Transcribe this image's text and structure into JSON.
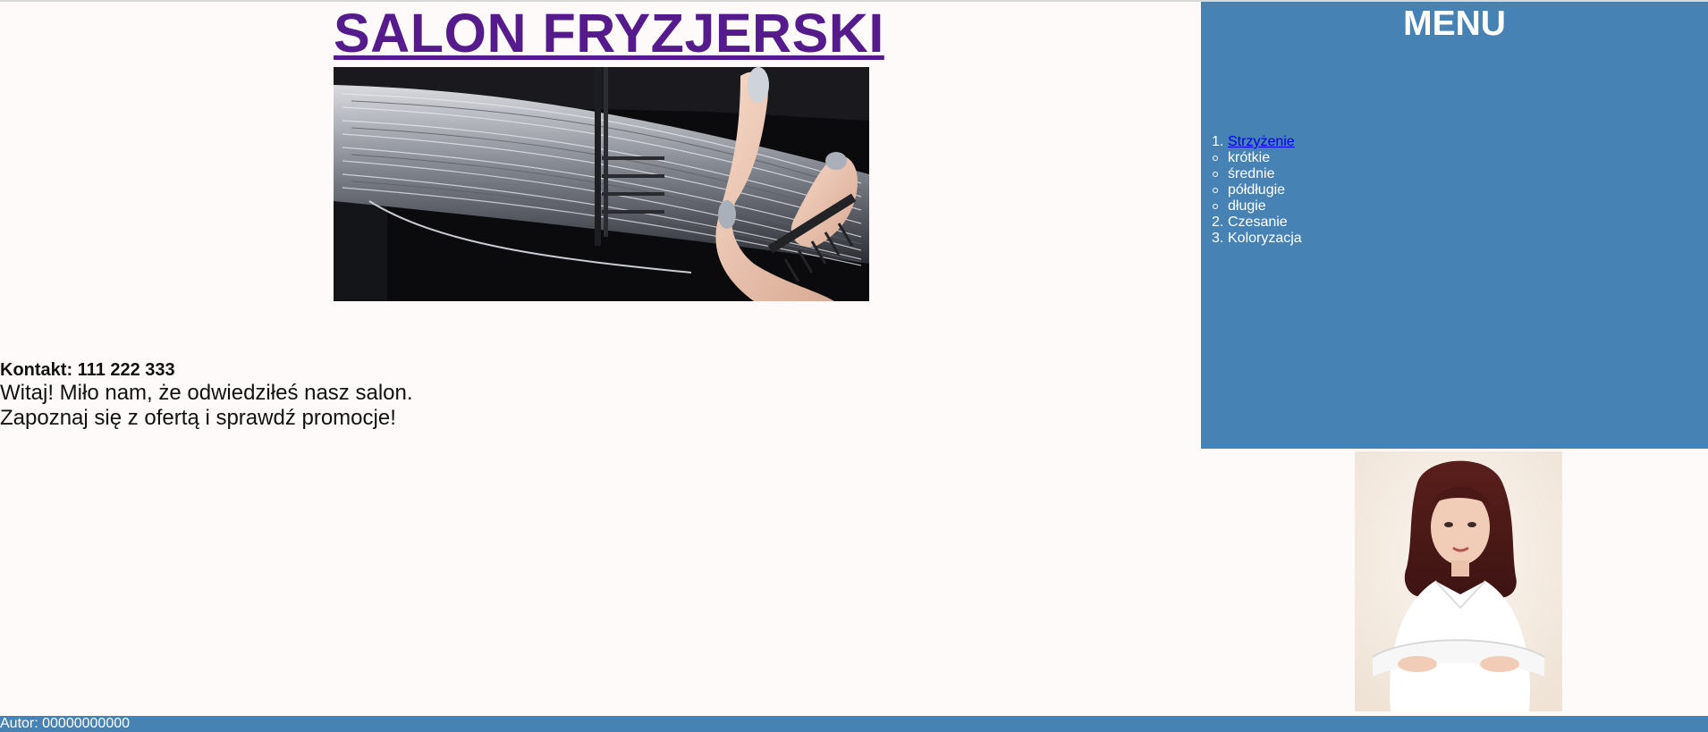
{
  "header": {
    "title": "SALON FRYZJERSKI"
  },
  "main": {
    "contact": "Kontakt: 111 222 333",
    "greeting_line1": "Witaj! Miło nam, że odwiedziłeś nasz salon.",
    "greeting_line2": "Zapoznaj się z ofertą i sprawdź promocje!"
  },
  "sidebar": {
    "heading": "MENU",
    "items": [
      {
        "marker": "1.",
        "label": "Strzyżenie"
      },
      {
        "marker": "○",
        "label": "krótkie"
      },
      {
        "marker": "○",
        "label": "średnie"
      },
      {
        "marker": "○",
        "label": "półdługie"
      },
      {
        "marker": "○",
        "label": "długie"
      },
      {
        "marker": "2.",
        "label": "Czesanie"
      },
      {
        "marker": "3.",
        "label": "Koloryzacja"
      }
    ]
  },
  "footer": {
    "author": "Autor: 00000000000"
  },
  "colors": {
    "title": "#551a8b",
    "sidebar_bg": "#4682b4",
    "footer_bg": "#4682b4",
    "page_bg": "#fffafa",
    "link": "#0000ee"
  }
}
